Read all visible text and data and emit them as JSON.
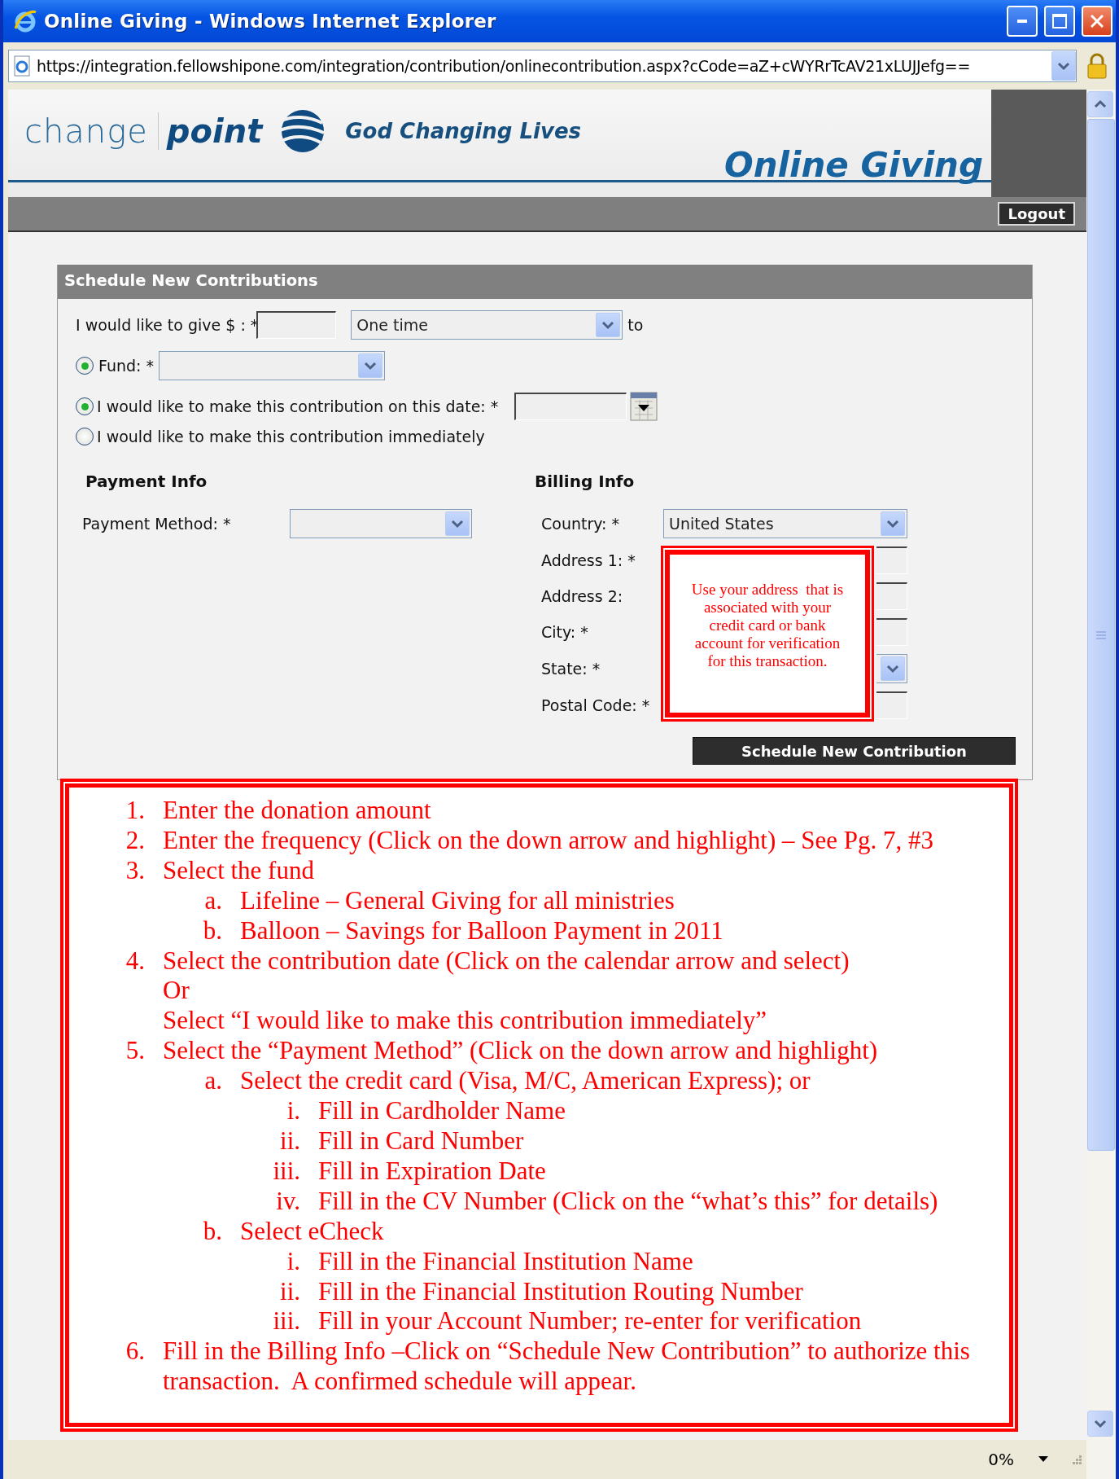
{
  "window": {
    "title": "Online Giving - Windows Internet Explorer",
    "address": "https://integration.fellowshipone.com/integration/contribution/onlinecontribution.aspx?cCode=aZ+cWYRrTcAV21xLUJJefg=="
  },
  "header": {
    "brand_light": "change",
    "brand_bold": "point",
    "tagline": "God Changing Lives",
    "title": "Online Giving",
    "logout": "Logout"
  },
  "form": {
    "title": "Schedule New Contributions",
    "amount_label": "I would like to give $ : *",
    "frequency": {
      "value": "One time"
    },
    "to": "to",
    "fund": {
      "label": "Fund: *",
      "selected": true
    },
    "date_options": [
      {
        "kind": "date",
        "label": "I would like to make this contribution on this date: *",
        "selected": true
      },
      {
        "kind": "plain",
        "label": "I would like to make this contribution immediately",
        "selected": false
      }
    ],
    "payment": {
      "heading": "Payment Info",
      "label": "Payment Method: *"
    },
    "billing": {
      "heading": "Billing Info",
      "fields": [
        {
          "kind": "select",
          "label": "Country: *",
          "value": "United States"
        },
        {
          "kind": "text",
          "label": "Address 1: *"
        },
        {
          "kind": "text",
          "label": "Address 2:"
        },
        {
          "kind": "text",
          "label": "City: *"
        },
        {
          "kind": "select",
          "label": "State: *"
        },
        {
          "kind": "text",
          "label": "Postal Code: *"
        }
      ]
    },
    "submit": "Schedule New Contribution"
  },
  "callout": "Use your address  that is associated with your credit card or bank account for verification for this transaction.",
  "instructions": [
    {
      "marker": "1.",
      "text": "Enter the donation amount"
    },
    {
      "marker": "2.",
      "text": "Enter the frequency (Click on the down arrow and highlight) – See Pg. 7, #3"
    },
    {
      "marker": "3.",
      "text": "Select the fund",
      "children": [
        {
          "marker": "a.",
          "text": "Lifeline – General Giving for all ministries"
        },
        {
          "marker": "b.",
          "text": "Balloon – Savings for Balloon Payment in 2011"
        }
      ]
    },
    {
      "marker": "4.",
      "text": "Select the contribution date (Click on the calendar arrow and select)",
      "continuation": [
        "Or",
        "Select “I would like to make this contribution immediately”"
      ]
    },
    {
      "marker": "5.",
      "text": "Select the “Payment Method” (Click on the down arrow and highlight)",
      "children": [
        {
          "marker": "a.",
          "text": "Select the credit card (Visa, M/C, American Express); or",
          "children": [
            {
              "marker": "i.",
              "text": "Fill in Cardholder Name"
            },
            {
              "marker": "ii.",
              "text": "Fill in Card Number"
            },
            {
              "marker": "iii.",
              "text": "Fill in Expiration Date"
            },
            {
              "marker": "iv.",
              "text": "Fill in the CV Number (Click on the “what’s this” for details)"
            }
          ]
        },
        {
          "marker": "b.",
          "text": "Select eCheck",
          "children": [
            {
              "marker": "i.",
              "text": "Fill in the Financial Institution Name"
            },
            {
              "marker": "ii.",
              "text": "Fill in the Financial Institution Routing Number"
            },
            {
              "marker": "iii.",
              "text": "Fill in your Account Number; re-enter for verification"
            }
          ]
        }
      ]
    },
    {
      "marker": "6.",
      "text": "Fill in the Billing Info –Click on “Schedule New Contribution” to authorize this transaction.  A confirmed schedule will appear."
    }
  ],
  "status_bar": {
    "zoom": "0%"
  }
}
